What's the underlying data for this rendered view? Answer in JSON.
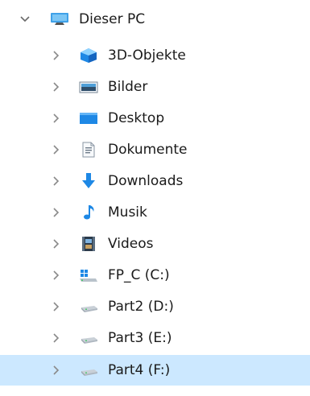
{
  "tree": {
    "root": {
      "label": "Dieser PC",
      "icon": "this-pc-icon",
      "expanded": true
    },
    "items": [
      {
        "label": "3D-Objekte",
        "icon": "3d-objects-icon"
      },
      {
        "label": "Bilder",
        "icon": "pictures-icon"
      },
      {
        "label": "Desktop",
        "icon": "desktop-icon"
      },
      {
        "label": "Dokumente",
        "icon": "documents-icon"
      },
      {
        "label": "Downloads",
        "icon": "downloads-icon"
      },
      {
        "label": "Musik",
        "icon": "music-icon"
      },
      {
        "label": "Videos",
        "icon": "videos-icon"
      },
      {
        "label": "FP_C (C:)",
        "icon": "system-drive-icon"
      },
      {
        "label": "Part2 (D:)",
        "icon": "drive-icon"
      },
      {
        "label": "Part3 (E:)",
        "icon": "drive-icon"
      },
      {
        "label": "Part4 (F:)",
        "icon": "drive-icon",
        "selected": true
      }
    ]
  },
  "colors": {
    "selection": "#cce8ff",
    "chevron": "#8a8a8a",
    "accent_blue": "#1e88e5"
  }
}
